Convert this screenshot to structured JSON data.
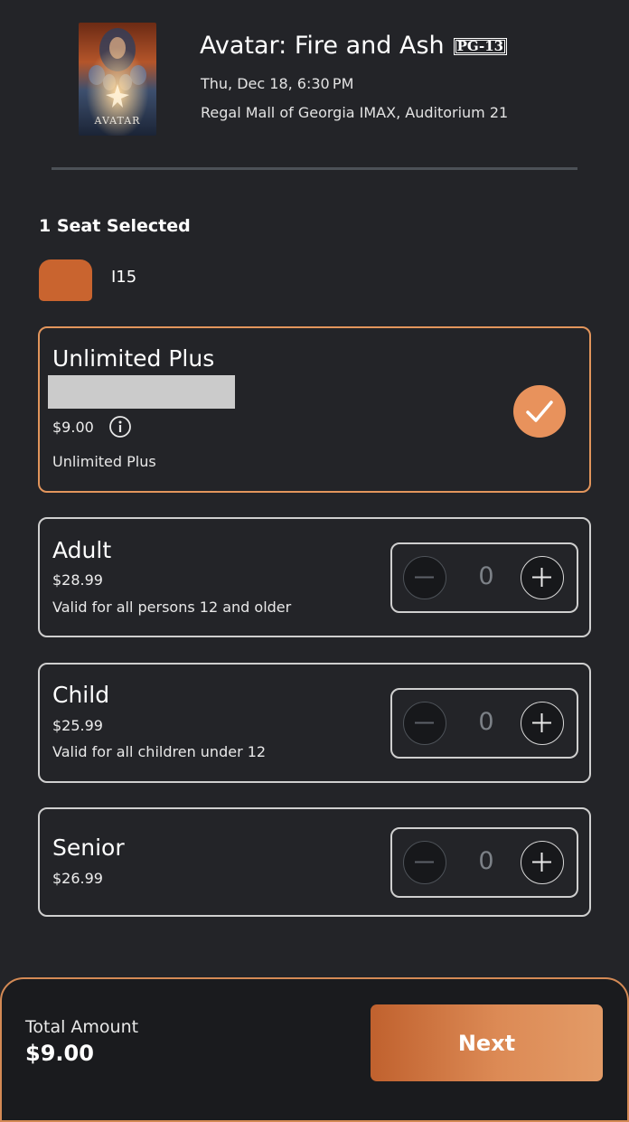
{
  "movie": {
    "title": "Avatar: Fire and Ash",
    "rating": "PG-13",
    "showtime": "Thu, Dec 18, 6:30 PM",
    "theater": "Regal Mall of Georgia IMAX, Auditorium 21",
    "poster_text": "AVATAR"
  },
  "seats": {
    "heading": "1 Seat Selected",
    "items": [
      {
        "label": "I15",
        "color": "#c9642f"
      }
    ]
  },
  "ticket_options": [
    {
      "name": "Unlimited Plus",
      "price": "$9.00",
      "description": "Unlimited Plus",
      "selected": true,
      "icons": [
        "info-icon",
        "check-icon"
      ]
    },
    {
      "name": "Adult",
      "price": "$28.99",
      "description": "Valid for all persons 12 and older",
      "quantity": "0"
    },
    {
      "name": "Child",
      "price": "$25.99",
      "description": "Valid for all children under 12",
      "quantity": "0"
    },
    {
      "name": "Senior",
      "price": "$26.99",
      "quantity": "0"
    }
  ],
  "footer": {
    "total_label": "Total Amount",
    "total_amount": "$9.00",
    "next_label": "Next"
  },
  "colors": {
    "background": "#232428",
    "accent": "#e2955c",
    "seat": "#c9642f",
    "check": "#e8925c",
    "button_gradient_start": "#c0612e",
    "button_gradient_end": "#e39b67"
  }
}
